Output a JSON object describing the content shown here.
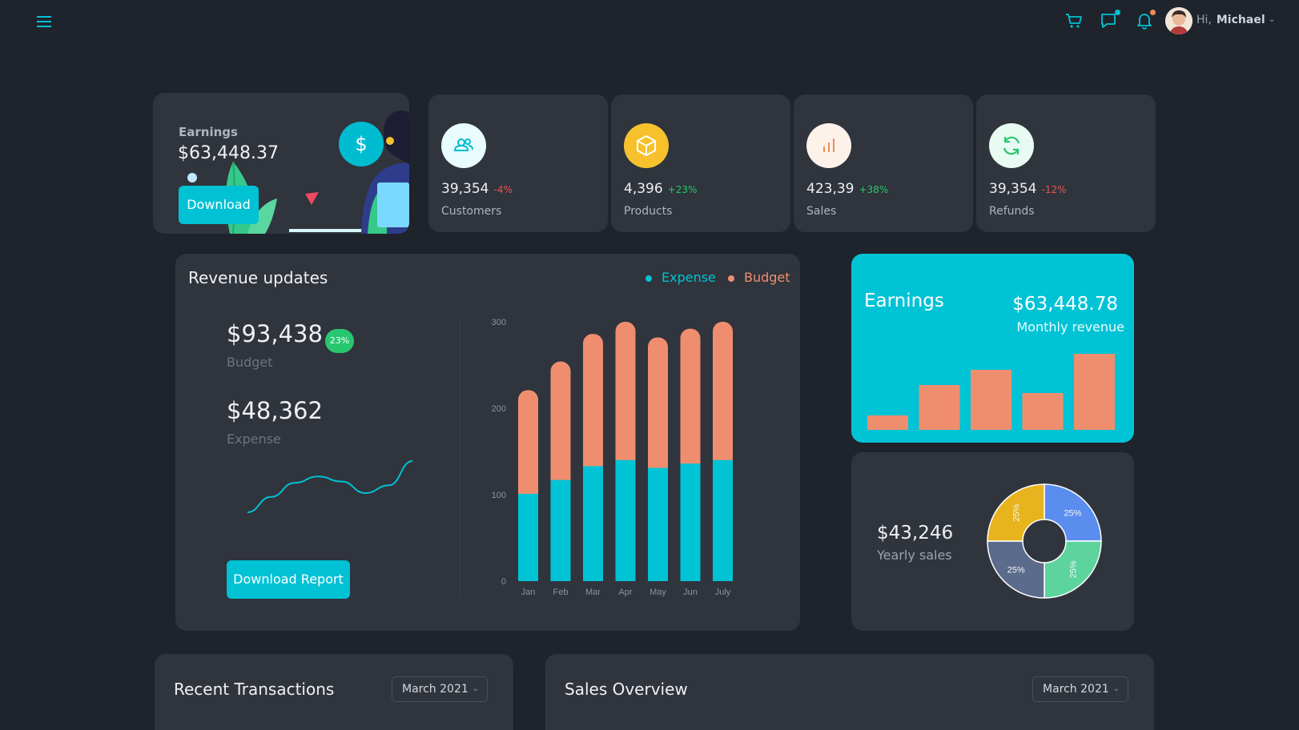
{
  "topbar": {
    "greeting": "Hi,",
    "user_name": "Michael",
    "icons": [
      "menu-icon",
      "cart-icon",
      "chat-icon",
      "bell-icon"
    ],
    "notification_colors": {
      "chat": "#00c2d4",
      "bell": "#f08a5d"
    }
  },
  "earnings_card": {
    "label": "Earnings",
    "value": "$63,448.37",
    "download_label": "Download",
    "currency_symbol": "$"
  },
  "stats": [
    {
      "value": "39,354",
      "change": "-4%",
      "label": "Customers",
      "icon": "users-icon",
      "icon_bg": "#e8fbfd",
      "icon_color": "#00bcd0",
      "change_color": "#ea5455"
    },
    {
      "value": "4,396",
      "change": "+23%",
      "label": "Products",
      "icon": "box-icon",
      "icon_bg": "#f6c12c",
      "icon_color": "#ffffff",
      "change_color": "#28c76f"
    },
    {
      "value": "423,39",
      "change": "+38%",
      "label": "Sales",
      "icon": "bar-chart-icon",
      "icon_bg": "#fdf2ea",
      "icon_color": "#f08a5d",
      "change_color": "#28c76f"
    },
    {
      "value": "39,354",
      "change": "-12%",
      "label": "Refunds",
      "icon": "refresh-icon",
      "icon_bg": "#e8fbf3",
      "icon_color": "#28c76f",
      "change_color": "#ea5455"
    }
  ],
  "revenue": {
    "title": "Revenue updates",
    "legend_expense": "Expense",
    "legend_budget": "Budget",
    "budget_value": "$93,438",
    "budget_label": "Budget",
    "badge": "23%",
    "expense_value": "$48,362",
    "expense_label": "Expense",
    "download_report_label": "Download Report"
  },
  "chart_data": [
    {
      "type": "bar",
      "stacked": true,
      "categories": [
        "Jan",
        "Feb",
        "Mar",
        "Apr",
        "May",
        "Jun",
        "July"
      ],
      "series": [
        {
          "name": "Expense",
          "values": [
            101,
            117,
            133,
            140,
            131,
            136,
            140
          ],
          "color": "#00c3d6"
        },
        {
          "name": "Budget",
          "values": [
            120,
            137,
            153,
            160,
            151,
            156,
            160
          ],
          "color": "#ef8e6e"
        }
      ],
      "yticks": [
        "0",
        "100",
        "200",
        "300"
      ],
      "ylim": [
        0,
        300
      ],
      "grid": false
    },
    {
      "type": "line",
      "values": [
        10,
        22,
        33,
        38,
        34,
        25,
        31,
        50
      ],
      "color": "#00c3d6",
      "axes": false
    },
    {
      "type": "bar",
      "values": [
        18,
        56,
        75,
        46,
        95
      ],
      "color": "#ef8e6e",
      "axes": false
    },
    {
      "type": "pie",
      "donut": true,
      "slices": [
        {
          "label": "25%",
          "value": 25,
          "color": "#5b8def"
        },
        {
          "label": "25%",
          "value": 25,
          "color": "#5dd39e"
        },
        {
          "label": "25%",
          "value": 25,
          "color": "#5b6b8c"
        },
        {
          "label": "25%",
          "value": 25,
          "color": "#e7b41d"
        }
      ]
    }
  ],
  "earnings_big": {
    "title": "Earnings",
    "value": "$63,448.78",
    "subtitle": "Monthly revenue"
  },
  "yearly": {
    "value": "$43,246",
    "label": "Yearly sales"
  },
  "transactions": {
    "title": "Recent Transactions",
    "period": "March 2021"
  },
  "sales_overview": {
    "title": "Sales Overview",
    "period": "March 2021"
  }
}
